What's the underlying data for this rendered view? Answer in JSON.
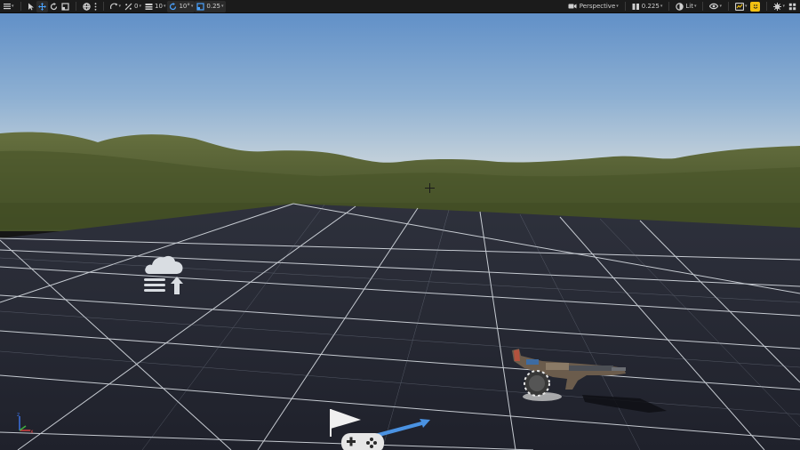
{
  "toolbar": {
    "rotation_snap_value": "0",
    "grid_snap_value": "10",
    "angle_snap_value": "10°",
    "scale_snap_value": "0.25",
    "view_mode_label": "Perspective",
    "camera_speed_value": "0.225",
    "lighting_mode_label": "Lit"
  },
  "icons": {
    "viewport_options": "hamburger-icon",
    "select": "arrow-cursor-icon",
    "translate": "move-arrows-icon",
    "rotate": "rotate-icon",
    "scale": "scale-icon",
    "world_local": "globe-icon",
    "more": "vertical-dots-icon",
    "surface_snap": "surface-snap-icon",
    "grid_snap": "grid-snap-icon",
    "angle_snap": "angle-snap-icon",
    "scale_snap": "scale-snap-icon",
    "camera": "camera-icon",
    "camera_speed": "speedometer-icon",
    "lit": "lit-sphere-icon",
    "show": "eye-icon",
    "realtime": "realtime-icon",
    "performance": "smile-icon",
    "settings": "gear-icon",
    "maximize": "maximize-icon"
  },
  "colors": {
    "sky_top": "#5f8fc8",
    "sky_horizon": "#cfd9de",
    "hills": "#4f5b2f",
    "floor": "#242733",
    "grid_line": "#d8dde3",
    "accent_yellow": "#f2c012"
  }
}
